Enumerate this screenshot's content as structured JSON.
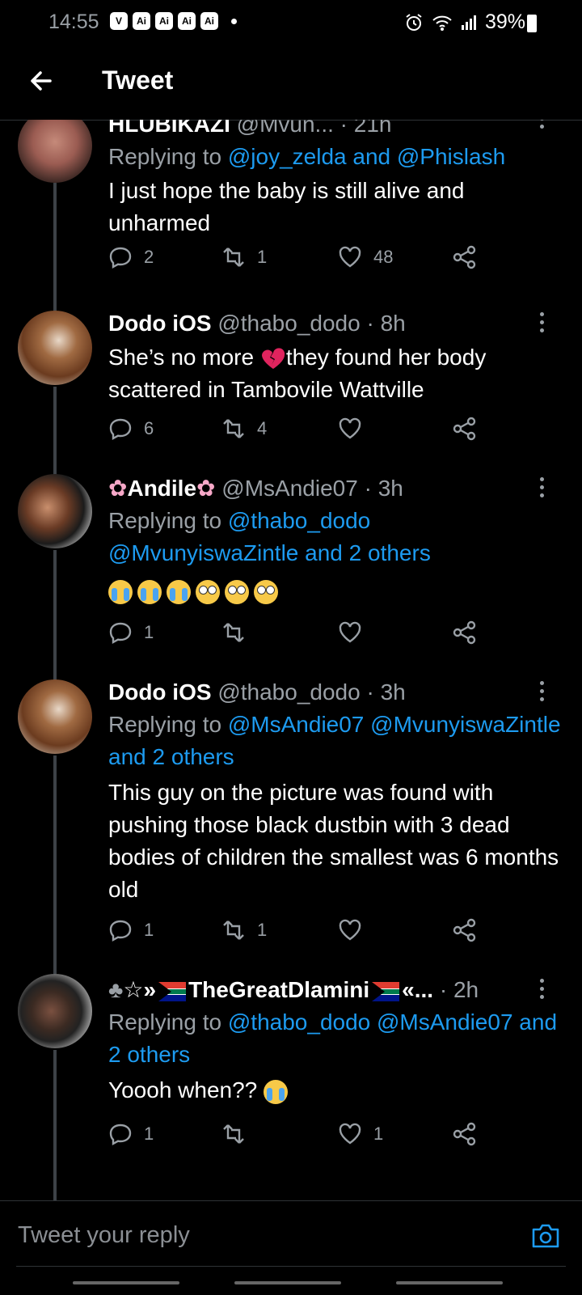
{
  "status_bar": {
    "time": "14:55",
    "app_icons": [
      "V",
      "Ai",
      "Ai",
      "Ai",
      "Ai"
    ],
    "battery": "39%"
  },
  "header": {
    "title": "Tweet"
  },
  "tweets": [
    {
      "name": "HLUBIKAZI",
      "handle": "@Mvun...",
      "time": "21h",
      "reply_prefix": "Replying to ",
      "reply_mentions": "@joy_zelda and @Phislash",
      "body": "I just hope the baby is still alive and unharmed",
      "replies": "2",
      "retweets": "1",
      "likes": "48"
    },
    {
      "name": "Dodo iOS",
      "handle": "@thabo_dodo",
      "time": "8h",
      "body_part1": "She’s no more ",
      "body_part2": "they found her body scattered in Tambovile Wattville",
      "replies": "6",
      "retweets": "4",
      "likes": ""
    },
    {
      "name": "Andile",
      "handle": "@MsAndie07",
      "time": "3h",
      "reply_prefix": "Replying to ",
      "reply_mentions": "@thabo_dodo @MvunyiswaZintle and 2 others",
      "replies": "1",
      "retweets": "",
      "likes": ""
    },
    {
      "name": "Dodo iOS",
      "handle": "@thabo_dodo",
      "time": "3h",
      "reply_prefix": "Replying to ",
      "reply_mentions": "@MsAndie07 @MvunyiswaZintle and 2 others",
      "body": "This guy on the picture was found with pushing those black dustbin with 3 dead bodies of children the smallest was 6 months old",
      "replies": "1",
      "retweets": "1",
      "likes": ""
    },
    {
      "name": "TheGreatDlamini",
      "name_prefix": "☆»",
      "name_suffix": "«...",
      "time": "2h",
      "reply_prefix": "Replying to ",
      "reply_mentions": "@thabo_dodo @MsAndie07 and 2 others",
      "body": "Yoooh when??",
      "replies": "1",
      "retweets": "",
      "likes": "1"
    }
  ],
  "compose": {
    "placeholder": "Tweet your reply"
  },
  "icons": {
    "back": "arrow-left-icon",
    "reply": "comment-icon",
    "retweet": "retweet-icon",
    "like": "heart-icon",
    "share": "share-icon",
    "camera": "camera-icon"
  },
  "colors": {
    "background": "#000000",
    "accent": "#1d9bf0",
    "secondary_text": "#9aa0a6"
  }
}
